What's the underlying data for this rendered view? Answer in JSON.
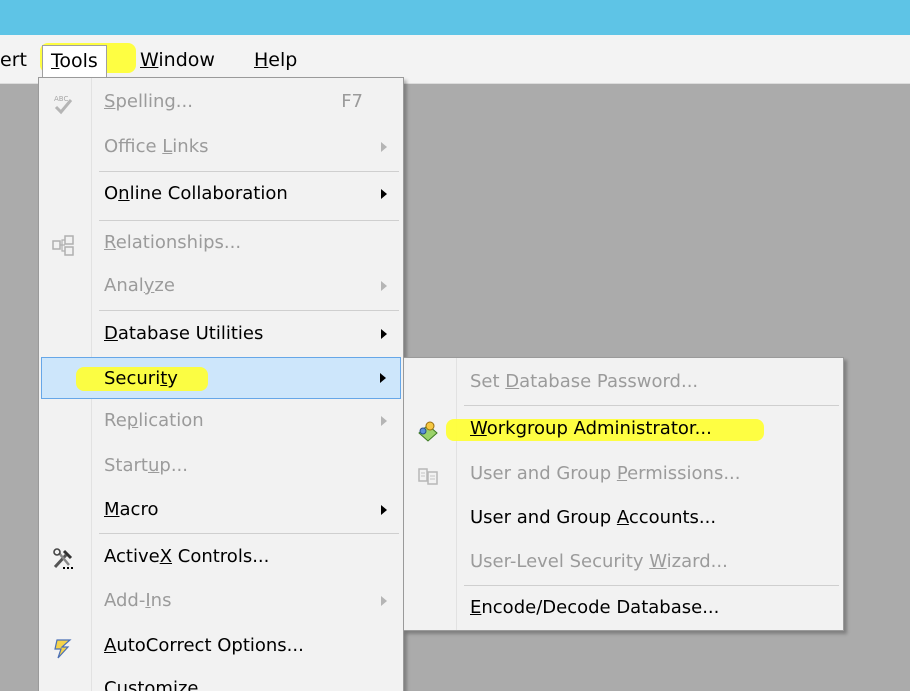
{
  "menubar": {
    "items": [
      {
        "label": "ert",
        "mnemonic": ""
      },
      {
        "label": "Tools",
        "mnemonic": "T"
      },
      {
        "label": "Window",
        "mnemonic": "W"
      },
      {
        "label": "Help",
        "mnemonic": "H"
      }
    ]
  },
  "tools_menu": {
    "items": [
      {
        "pre": "",
        "u": "S",
        "post": "pelling...",
        "shortcut": "F7",
        "enabled": false,
        "submenu": false,
        "icon": "spelling-icon"
      },
      {
        "pre": "Office ",
        "u": "L",
        "post": "inks",
        "shortcut": "",
        "enabled": false,
        "submenu": true,
        "icon": ""
      },
      {
        "pre": "O",
        "u": "n",
        "post": "line Collaboration",
        "shortcut": "",
        "enabled": true,
        "submenu": true,
        "icon": ""
      },
      {
        "pre": "",
        "u": "R",
        "post": "elationships...",
        "shortcut": "",
        "enabled": false,
        "submenu": false,
        "icon": "relationships-icon"
      },
      {
        "pre": "Anal",
        "u": "y",
        "post": "ze",
        "shortcut": "",
        "enabled": false,
        "submenu": true,
        "icon": ""
      },
      {
        "pre": "",
        "u": "D",
        "post": "atabase Utilities",
        "shortcut": "",
        "enabled": true,
        "submenu": true,
        "icon": ""
      },
      {
        "pre": "Securi",
        "u": "t",
        "post": "y",
        "shortcut": "",
        "enabled": true,
        "submenu": true,
        "icon": "",
        "selected": true
      },
      {
        "pre": "Re",
        "u": "p",
        "post": "lication",
        "shortcut": "",
        "enabled": false,
        "submenu": true,
        "icon": ""
      },
      {
        "pre": "Start",
        "u": "u",
        "post": "p...",
        "shortcut": "",
        "enabled": false,
        "submenu": false,
        "icon": ""
      },
      {
        "pre": "",
        "u": "M",
        "post": "acro",
        "shortcut": "",
        "enabled": true,
        "submenu": true,
        "icon": ""
      },
      {
        "pre": "Active",
        "u": "X",
        "post": " Controls...",
        "shortcut": "",
        "enabled": true,
        "submenu": false,
        "icon": "activex-tools-icon"
      },
      {
        "pre": "Add-",
        "u": "I",
        "post": "ns",
        "shortcut": "",
        "enabled": false,
        "submenu": true,
        "icon": ""
      },
      {
        "pre": "",
        "u": "A",
        "post": "utoCorrect Options...",
        "shortcut": "",
        "enabled": true,
        "submenu": false,
        "icon": "autocorrect-icon"
      },
      {
        "pre": "",
        "u": "C",
        "post": "ustomize...",
        "shortcut": "",
        "enabled": true,
        "submenu": false,
        "icon": ""
      }
    ]
  },
  "security_submenu": {
    "items": [
      {
        "pre": "Set ",
        "u": "D",
        "post": "atabase Password...",
        "enabled": false,
        "icon": ""
      },
      {
        "pre": "",
        "u": "W",
        "post": "orkgroup Administrator...",
        "enabled": true,
        "icon": "workgroup-admin-icon"
      },
      {
        "pre": "User and Group ",
        "u": "P",
        "post": "ermissions...",
        "enabled": false,
        "icon": "permissions-icon"
      },
      {
        "pre": "User and Group ",
        "u": "A",
        "post": "ccounts...",
        "enabled": true,
        "icon": ""
      },
      {
        "pre": "User-Level Security ",
        "u": "W",
        "post": "izard...",
        "enabled": false,
        "icon": ""
      },
      {
        "pre": "",
        "u": "E",
        "post": "ncode/Decode Database...",
        "enabled": true,
        "icon": ""
      }
    ]
  },
  "colors": {
    "titlebar": "#5ec4e6",
    "workspace": "#ababab",
    "highlighter": "#ffff33",
    "selection": "#cde6fb",
    "selection_border": "#66a7e8"
  }
}
